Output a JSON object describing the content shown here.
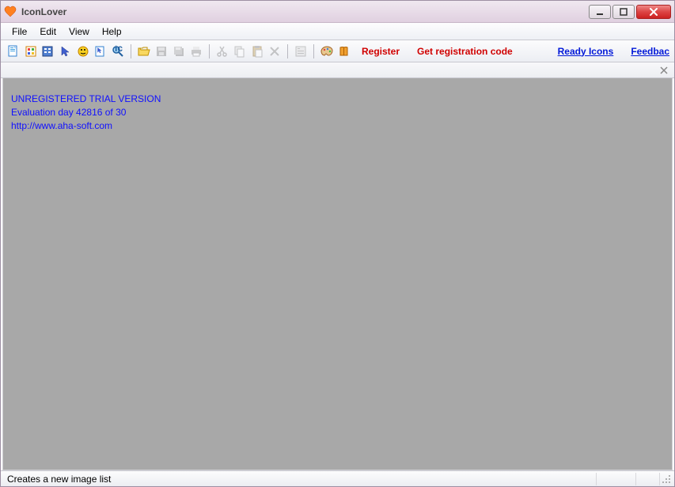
{
  "title": "IconLover",
  "menus": {
    "file": "File",
    "edit": "Edit",
    "view": "View",
    "help": "Help"
  },
  "links": {
    "register": "Register",
    "getcode": "Get registration code",
    "readyicons": "Ready Icons",
    "feedback": "Feedbac"
  },
  "trial": {
    "line1": "UNREGISTERED TRIAL VERSION",
    "line2": "Evaluation day 42816 of 30",
    "line3": "http://www.aha-soft.com"
  },
  "status": "Creates a new image list"
}
